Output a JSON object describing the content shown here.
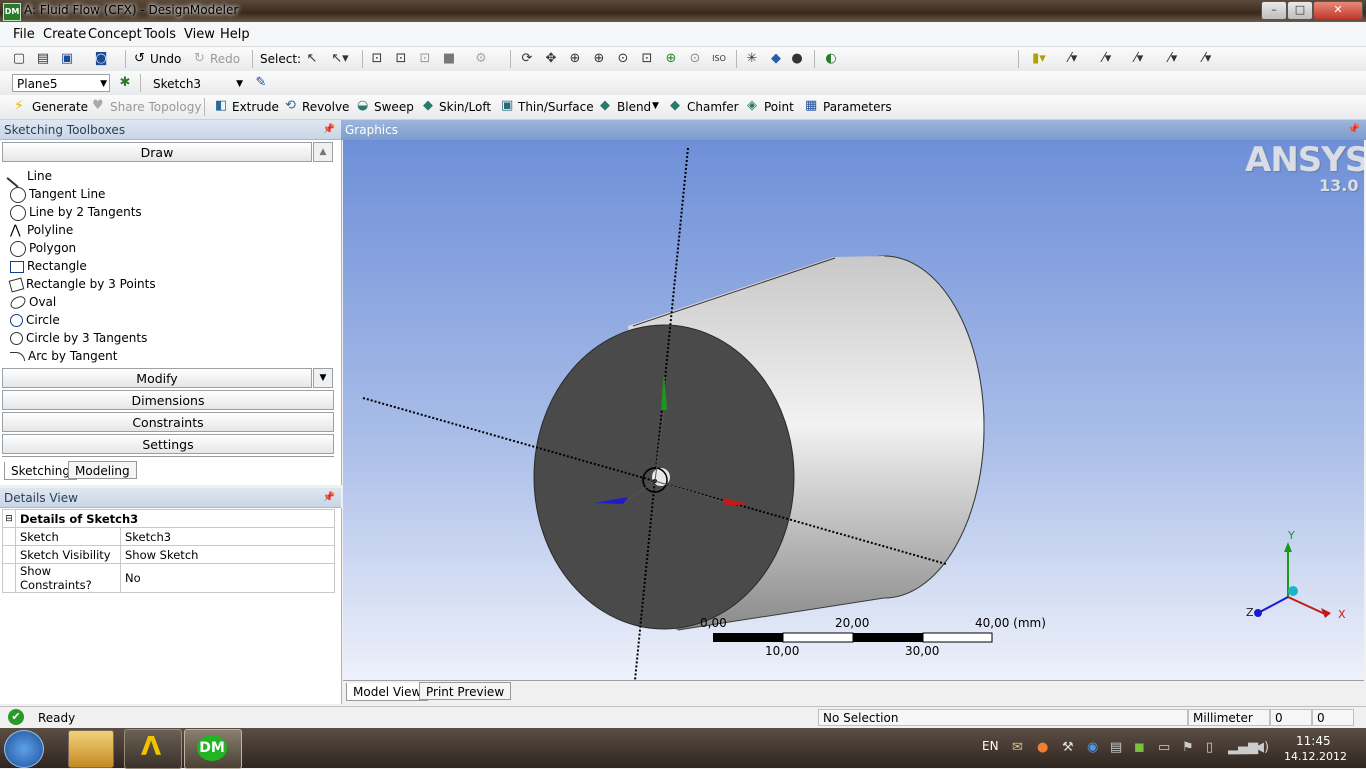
{
  "window": {
    "title": "A: Fluid Flow (CFX) - DesignModeler",
    "icon": "DM",
    "buttons": {
      "minimize": "–",
      "maximize": "□",
      "close": "✕"
    }
  },
  "menu": [
    "File",
    "Create",
    "Concept",
    "Tools",
    "View",
    "Help"
  ],
  "toolbar1": {
    "undo": "Undo",
    "redo": "Redo",
    "select": "Select:"
  },
  "toolbar2": {
    "plane": "Plane5",
    "sketch": "Sketch3"
  },
  "toolbar3": {
    "generate": "Generate",
    "share_topology": "Share Topology",
    "extrude": "Extrude",
    "revolve": "Revolve",
    "sweep": "Sweep",
    "skin_loft": "Skin/Loft",
    "thin_surface": "Thin/Surface",
    "blend": "Blend",
    "chamfer": "Chamfer",
    "point": "Point",
    "parameters": "Parameters"
  },
  "sketching_toolboxes": {
    "title": "Sketching Toolboxes",
    "draw": "Draw",
    "draw_items": [
      "Line",
      "Tangent Line",
      "Line by 2 Tangents",
      "Polyline",
      "Polygon",
      "Rectangle",
      "Rectangle by 3 Points",
      "Oval",
      "Circle",
      "Circle by 3 Tangents",
      "Arc by Tangent"
    ],
    "modify": "Modify",
    "dimensions": "Dimensions",
    "constraints": "Constraints",
    "settings": "Settings",
    "tabs": [
      "Sketching",
      "Modeling"
    ]
  },
  "details_view": {
    "title": "Details View",
    "heading": "Details of Sketch3",
    "rows": [
      {
        "label": "Sketch",
        "value": "Sketch3"
      },
      {
        "label": "Sketch Visibility",
        "value": "Show Sketch"
      },
      {
        "label": "Show Constraints?",
        "value": "No"
      }
    ]
  },
  "graphics": {
    "title": "Graphics",
    "logo": "ANSYS",
    "version": "13.0",
    "scale_top": [
      "0,00",
      "20,00",
      "40,00 (mm)"
    ],
    "scale_bottom": [
      "10,00",
      "30,00"
    ],
    "triad": {
      "x": "X",
      "y": "Y",
      "z": "Z"
    },
    "tabs": [
      "Model View",
      "Print Preview"
    ]
  },
  "status": {
    "ready": "Ready",
    "selection": "No Selection",
    "units": "Millimeter",
    "v1": "0",
    "v2": "0"
  },
  "taskbar": {
    "lang": "EN",
    "time": "11:45",
    "date": "14.12.2012",
    "dm": "DM"
  }
}
